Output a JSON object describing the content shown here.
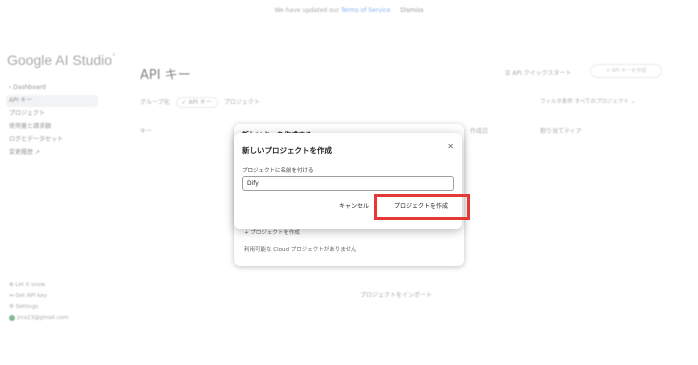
{
  "banner": {
    "text_before": "We have updated our",
    "link": "Terms of Service",
    "dismiss": "Dismiss"
  },
  "sidebar": {
    "logo": "Google AI Studio",
    "items": [
      {
        "label": "‹ Dashboard"
      },
      {
        "label": "API キー"
      },
      {
        "label": "プロジェクト"
      },
      {
        "label": "使用量と請求額"
      },
      {
        "label": "ログとデータセット"
      },
      {
        "label": "変更履歴 ↗"
      }
    ],
    "footer": [
      {
        "label": "⊕ Let it snow"
      },
      {
        "label": "⇔ Get API key"
      },
      {
        "label": "⚙ Settings"
      },
      {
        "label": "jrco23@gmail.com"
      }
    ]
  },
  "main": {
    "title": "API キー",
    "quickstart": "☰ API クイックスタート",
    "create_key_button": "+ API キーを作成",
    "filter_group_label": "グループ化",
    "filter_chip": "✓ API キー",
    "filter_project": "プロジェクト",
    "filter_right": "フィルタ条件  すべてのプロジェクト  ⌄",
    "columns": [
      "キー",
      "作成日",
      "割り当てティア"
    ],
    "import_link": "プロジェクトをインポート"
  },
  "bg_dialog": {
    "title": "新しいキーを作成する",
    "create_project": "+  プロジェクトを作成",
    "no_projects": "利用可能な Cloud プロジェクトがありません"
  },
  "modal": {
    "title": "新しいプロジェクトを作成",
    "close_icon": "close-icon",
    "field_label": "プロジェクトに名前を付ける",
    "input_value": "Dify",
    "cancel": "キャンセル",
    "create": "プロジェクトを作成",
    "highlight_color": "#e53935"
  }
}
